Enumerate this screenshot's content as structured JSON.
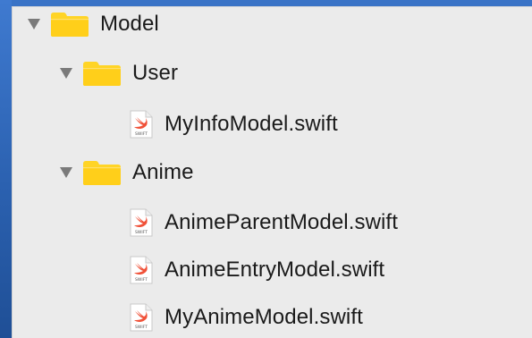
{
  "tree": {
    "model": {
      "label": "Model",
      "expanded": true,
      "icon": "folder-icon"
    },
    "user": {
      "label": "User",
      "expanded": true,
      "icon": "folder-icon",
      "files": [
        {
          "label": "MyInfoModel.swift",
          "icon": "swift-file-icon"
        }
      ]
    },
    "anime": {
      "label": "Anime",
      "expanded": true,
      "icon": "folder-icon",
      "files": [
        {
          "label": "AnimeParentModel.swift",
          "icon": "swift-file-icon"
        },
        {
          "label": "AnimeEntryModel.swift",
          "icon": "swift-file-icon"
        },
        {
          "label": "MyAnimeModel.swift",
          "icon": "swift-file-icon"
        }
      ]
    }
  },
  "swift_icon_caption": "SWIFT",
  "colors": {
    "folder": "#ffd426",
    "swift_orange": "#f05138",
    "disclosure": "#7a7a7a",
    "text": "#1a1a1a",
    "panel": "#ebebeb",
    "desktop": "#2a63b3"
  }
}
